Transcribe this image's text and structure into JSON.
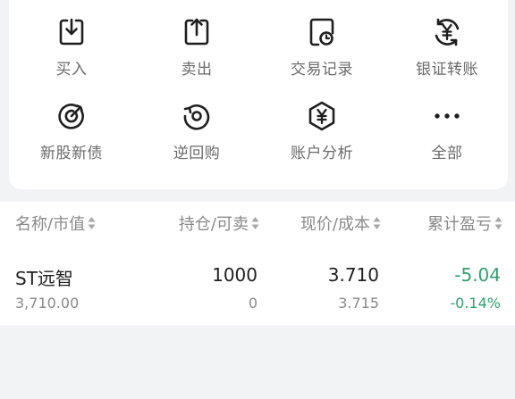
{
  "quick_actions": [
    {
      "label": "买入",
      "icon": "buy-icon"
    },
    {
      "label": "卖出",
      "icon": "sell-icon"
    },
    {
      "label": "交易记录",
      "icon": "trade-record-icon"
    },
    {
      "label": "银证转账",
      "icon": "bank-transfer-icon"
    },
    {
      "label": "新股新债",
      "icon": "ipo-target-icon"
    },
    {
      "label": "逆回购",
      "icon": "reverse-repo-icon"
    },
    {
      "label": "账户分析",
      "icon": "account-analysis-icon"
    },
    {
      "label": "全部",
      "icon": "more-icon"
    }
  ],
  "table": {
    "headers": [
      "名称/市值",
      "持仓/可卖",
      "现价/成本",
      "累计盈亏"
    ],
    "rows": [
      {
        "name": "ST远智",
        "market_value": "3,710.00",
        "position": "1000",
        "sellable": "0",
        "price": "3.710",
        "cost": "3.715",
        "pnl": "-5.04",
        "pnl_pct": "-0.14%"
      }
    ]
  },
  "colors": {
    "icon": "#1f1f1f",
    "label": "#6a6a6a",
    "loss": "#2ea36b",
    "background": "#f2f3f5"
  }
}
